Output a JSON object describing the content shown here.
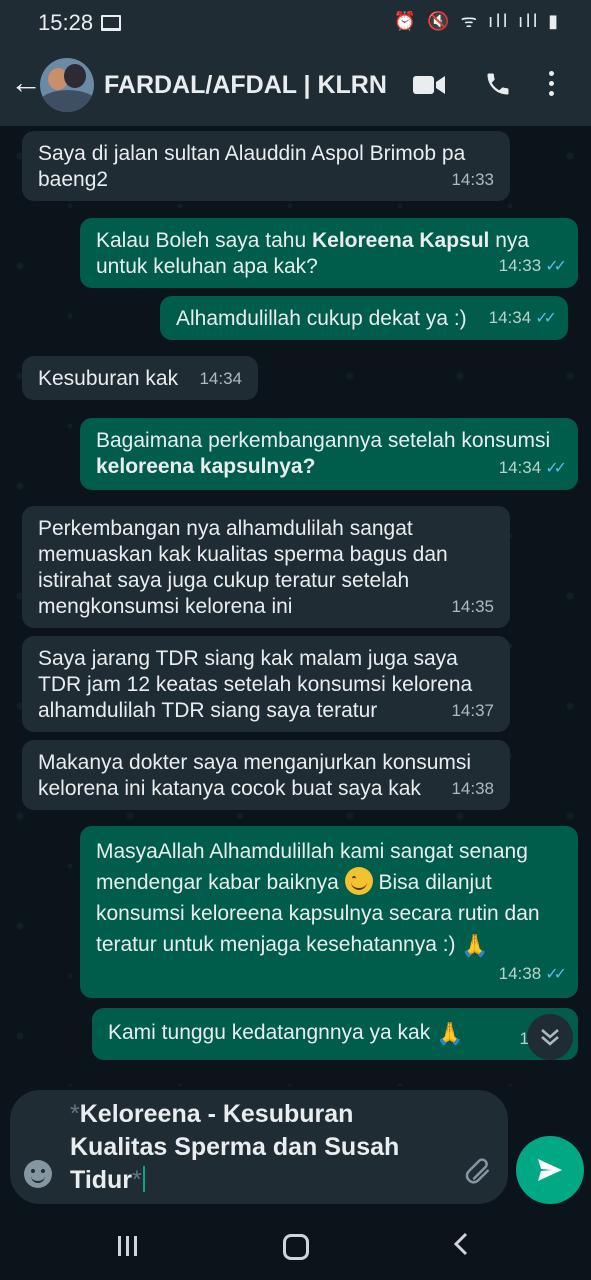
{
  "status_bar": {
    "time": "15:28",
    "indicators": "⏰ 🔇 ᯤ ıll ıll ▮"
  },
  "header": {
    "contact_name": "FARDAL/AFDAL | KLRN",
    "icons": [
      "back-arrow-icon",
      "avatar",
      "video-call-icon",
      "voice-call-icon",
      "more-options-icon"
    ]
  },
  "messages": [
    {
      "direction": "in",
      "text": "Saya di jalan sultan Alauddin Aspol Brimob pa baeng2",
      "time": "14:33"
    },
    {
      "direction": "out",
      "parts": [
        "Kalau Boleh saya tahu ",
        "Keloreena Kapsul",
        " nya untuk keluhan apa kak?"
      ],
      "time": "14:33",
      "read": true
    },
    {
      "direction": "out",
      "text": "Alhamdulillah cukup dekat ya :)",
      "time": "14:34",
      "read": true
    },
    {
      "direction": "in",
      "text": "Kesuburan kak",
      "time": "14:34"
    },
    {
      "direction": "out",
      "parts": [
        "Bagaimana perkembangannya setelah konsumsi ",
        "keloreena kapsulnya?"
      ],
      "time": "14:34",
      "read": true
    },
    {
      "direction": "in",
      "text": "Perkembangan nya alhamdulilah sangat memuaskan kak kualitas sperma bagus dan istirahat saya juga cukup teratur setelah mengkonsumsi kelorena ini",
      "time": "14:35"
    },
    {
      "direction": "in",
      "text": "Saya jarang TDR siang kak malam juga saya TDR jam 12 keatas setelah konsumsi kelorena alhamdulilah TDR siang saya teratur",
      "time": "14:37"
    },
    {
      "direction": "in",
      "text": "Makanya dokter saya menganjurkan konsumsi kelorena ini katanya cocok buat saya kak",
      "time": "14:38"
    },
    {
      "direction": "out",
      "parts": [
        "MasyaAllah Alhamdulillah kami sangat senang mendengar kabar baiknya",
        " Bisa dilanjut konsumsi keloreena kapsulnya secara rutin dan teratur untuk menjaga kesehatannya :) "
      ],
      "time": "14:38",
      "read": true
    },
    {
      "direction": "out",
      "text": "Kami tunggu kedatangnnya ya kak ",
      "time": "14:38"
    }
  ],
  "composer": {
    "star_open": "*",
    "text": "Keloreena - Kesuburan Kualitas Sperma dan Susah Tidur",
    "star_close": "*"
  },
  "colors": {
    "background": "#0b141a",
    "header": "#1f2c34",
    "incoming_bubble": "#1f2c34",
    "outgoing_bubble": "#005c4b",
    "accent": "#00a884",
    "read_ticks": "#53bdeb"
  },
  "ticks": "✓✓"
}
